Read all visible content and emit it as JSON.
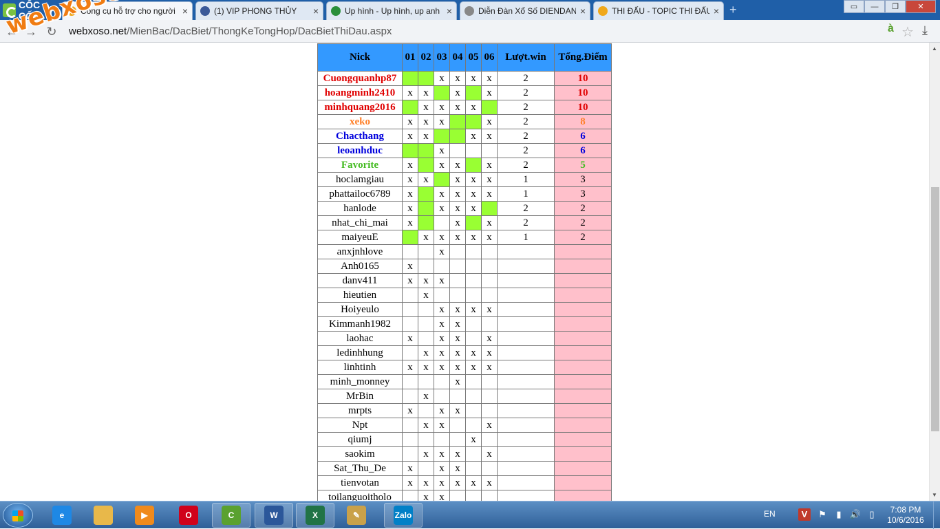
{
  "browser": {
    "brand": "CỐC CỐC",
    "tabs": [
      {
        "title": "Công cụ hỗ trợ cho người",
        "active": true,
        "favicon": "xs-icon",
        "color": "#f0a81b"
      },
      {
        "title": "(1) VIP PHONG THỦY",
        "active": false,
        "favicon": "facebook-icon",
        "color": "#3b5998"
      },
      {
        "title": "Up hình - Up hình, up anh",
        "active": false,
        "favicon": "image-host-icon",
        "color": "#2a8f3a"
      },
      {
        "title": "Diễn Đàn Xổ Số DIENDAN",
        "active": false,
        "favicon": "page-icon",
        "color": "#888888"
      },
      {
        "title": "THI ĐẤU - TOPIC THI ĐẤU",
        "active": false,
        "favicon": "xs-icon",
        "color": "#f0a81b"
      }
    ],
    "url_prefix": "",
    "url_domain": "webxoso.net",
    "url_path": "/MienBac/DacBiet/ThongKeTongHop/DacBietThiDau.aspx",
    "watermark": "webxoso.net"
  },
  "table": {
    "headers": {
      "nick": "Nick",
      "days": [
        "01",
        "02",
        "03",
        "04",
        "05",
        "06"
      ],
      "wins": "Lượt.win",
      "points": "Tổng.Điểm"
    },
    "rows": [
      {
        "nick": "Cuongquanhp87",
        "tier": "red",
        "cells": [
          "g",
          "g",
          "x",
          "x",
          "x",
          "x"
        ],
        "wins": "2",
        "points": "10"
      },
      {
        "nick": "hoangminh2410",
        "tier": "red",
        "cells": [
          "x",
          "x",
          "g",
          "x",
          "g",
          "x"
        ],
        "wins": "2",
        "points": "10"
      },
      {
        "nick": "minhquang2016",
        "tier": "red",
        "cells": [
          "g",
          "x",
          "x",
          "x",
          "x",
          "g"
        ],
        "wins": "2",
        "points": "10"
      },
      {
        "nick": "xeko",
        "tier": "orange",
        "cells": [
          "x",
          "x",
          "x",
          "g",
          "g",
          "x"
        ],
        "wins": "2",
        "points": "8"
      },
      {
        "nick": "Chacthang",
        "tier": "blue",
        "cells": [
          "x",
          "x",
          "g",
          "g",
          "x",
          "x"
        ],
        "wins": "2",
        "points": "6"
      },
      {
        "nick": "leoanhduc",
        "tier": "blue",
        "cells": [
          "g",
          "g",
          "x",
          "",
          "",
          ""
        ],
        "wins": "2",
        "points": "6"
      },
      {
        "nick": "Favorite",
        "tier": "green",
        "cells": [
          "x",
          "g",
          "x",
          "x",
          "g",
          "x"
        ],
        "wins": "2",
        "points": "5"
      },
      {
        "nick": "hoclamgiau",
        "tier": "",
        "cells": [
          "x",
          "x",
          "g",
          "x",
          "x",
          "x"
        ],
        "wins": "1",
        "points": "3"
      },
      {
        "nick": "phattailoc6789",
        "tier": "",
        "cells": [
          "x",
          "g",
          "x",
          "x",
          "x",
          "x"
        ],
        "wins": "1",
        "points": "3"
      },
      {
        "nick": "hanlode",
        "tier": "",
        "cells": [
          "x",
          "g",
          "x",
          "x",
          "x",
          "g"
        ],
        "wins": "2",
        "points": "2"
      },
      {
        "nick": "nhat_chi_mai",
        "tier": "",
        "cells": [
          "x",
          "g",
          "",
          "x",
          "g",
          "x"
        ],
        "wins": "2",
        "points": "2"
      },
      {
        "nick": "maiyeuE",
        "tier": "",
        "cells": [
          "g",
          "x",
          "x",
          "x",
          "x",
          "x"
        ],
        "wins": "1",
        "points": "2"
      },
      {
        "nick": "anxjnhlove",
        "tier": "",
        "cells": [
          "",
          "",
          "x",
          "",
          "",
          ""
        ],
        "wins": "",
        "points": ""
      },
      {
        "nick": "Anh0165",
        "tier": "",
        "cells": [
          "x",
          "",
          "",
          "",
          "",
          ""
        ],
        "wins": "",
        "points": ""
      },
      {
        "nick": "danv411",
        "tier": "",
        "cells": [
          "x",
          "x",
          "x",
          "",
          "",
          ""
        ],
        "wins": "",
        "points": ""
      },
      {
        "nick": "hieutien",
        "tier": "",
        "cells": [
          "",
          "x",
          "",
          "",
          "",
          ""
        ],
        "wins": "",
        "points": ""
      },
      {
        "nick": "Hoiyeulo",
        "tier": "",
        "cells": [
          "",
          "",
          "x",
          "x",
          "x",
          "x"
        ],
        "wins": "",
        "points": ""
      },
      {
        "nick": "Kimmanh1982",
        "tier": "",
        "cells": [
          "",
          "",
          "x",
          "x",
          "",
          ""
        ],
        "wins": "",
        "points": ""
      },
      {
        "nick": "laohac",
        "tier": "",
        "cells": [
          "x",
          "",
          "x",
          "x",
          "",
          "x"
        ],
        "wins": "",
        "points": ""
      },
      {
        "nick": "ledinhhung",
        "tier": "",
        "cells": [
          "",
          "x",
          "x",
          "x",
          "x",
          "x"
        ],
        "wins": "",
        "points": ""
      },
      {
        "nick": "linhtinh",
        "tier": "",
        "cells": [
          "x",
          "x",
          "x",
          "x",
          "x",
          "x"
        ],
        "wins": "",
        "points": ""
      },
      {
        "nick": "minh_monney",
        "tier": "",
        "cells": [
          "",
          "",
          "",
          "x",
          "",
          ""
        ],
        "wins": "",
        "points": ""
      },
      {
        "nick": "MrBin",
        "tier": "",
        "cells": [
          "",
          "x",
          "",
          "",
          "",
          ""
        ],
        "wins": "",
        "points": ""
      },
      {
        "nick": "mrpts",
        "tier": "",
        "cells": [
          "x",
          "",
          "x",
          "x",
          "",
          ""
        ],
        "wins": "",
        "points": ""
      },
      {
        "nick": "Npt",
        "tier": "",
        "cells": [
          "",
          "x",
          "x",
          "",
          "",
          "x"
        ],
        "wins": "",
        "points": ""
      },
      {
        "nick": "qiumj",
        "tier": "",
        "cells": [
          "",
          "",
          "",
          "",
          "x",
          ""
        ],
        "wins": "",
        "points": ""
      },
      {
        "nick": "saokim",
        "tier": "",
        "cells": [
          "",
          "x",
          "x",
          "x",
          "",
          "x"
        ],
        "wins": "",
        "points": ""
      },
      {
        "nick": "Sat_Thu_De",
        "tier": "",
        "cells": [
          "x",
          "",
          "x",
          "x",
          "",
          ""
        ],
        "wins": "",
        "points": ""
      },
      {
        "nick": "tienvotan",
        "tier": "",
        "cells": [
          "x",
          "x",
          "x",
          "x",
          "x",
          "x"
        ],
        "wins": "",
        "points": ""
      },
      {
        "nick": "toilanguoitholo",
        "tier": "",
        "cells": [
          "",
          "x",
          "x",
          "",
          "",
          ""
        ],
        "wins": "",
        "points": ""
      }
    ]
  },
  "taskbar": {
    "apps": [
      {
        "name": "ie-icon",
        "color": "#1e88e5",
        "open": false,
        "label": "e"
      },
      {
        "name": "explorer-icon",
        "color": "#e8b84a",
        "open": false,
        "label": ""
      },
      {
        "name": "media-player-icon",
        "color": "#f08a1c",
        "open": false,
        "label": "▶"
      },
      {
        "name": "opera-icon",
        "color": "#d0021b",
        "open": false,
        "label": "O"
      },
      {
        "name": "coccoc-icon",
        "color": "#5aa12f",
        "open": true,
        "label": "C"
      },
      {
        "name": "word-icon",
        "color": "#2b579a",
        "open": true,
        "label": "W"
      },
      {
        "name": "excel-icon",
        "color": "#217346",
        "open": true,
        "label": "X"
      },
      {
        "name": "paint-icon",
        "color": "#c9a14a",
        "open": false,
        "label": "✎"
      },
      {
        "name": "zalo-icon",
        "color": "#0180c7",
        "open": true,
        "label": "Zalo"
      }
    ],
    "lang": "EN",
    "time": "7:08 PM",
    "date": "10/6/2016"
  }
}
